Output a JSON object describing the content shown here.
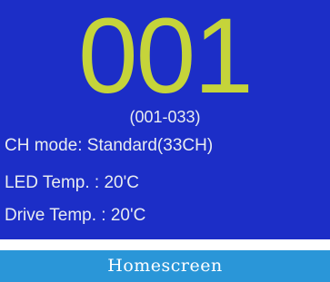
{
  "screen": {
    "channel_number": "001",
    "channel_range": "(001-033)",
    "ch_mode": "CH mode: Standard(33CH)",
    "led_temp": "LED Temp. : 20'C",
    "drive_temp": "Drive Temp. : 20'C"
  },
  "caption": {
    "label": "Homescreen"
  },
  "colors": {
    "screen_background": "#1c2ec7",
    "channel_number": "#c5d43a",
    "text": "#e8ecf0",
    "caption_background": "#2a96d8"
  }
}
